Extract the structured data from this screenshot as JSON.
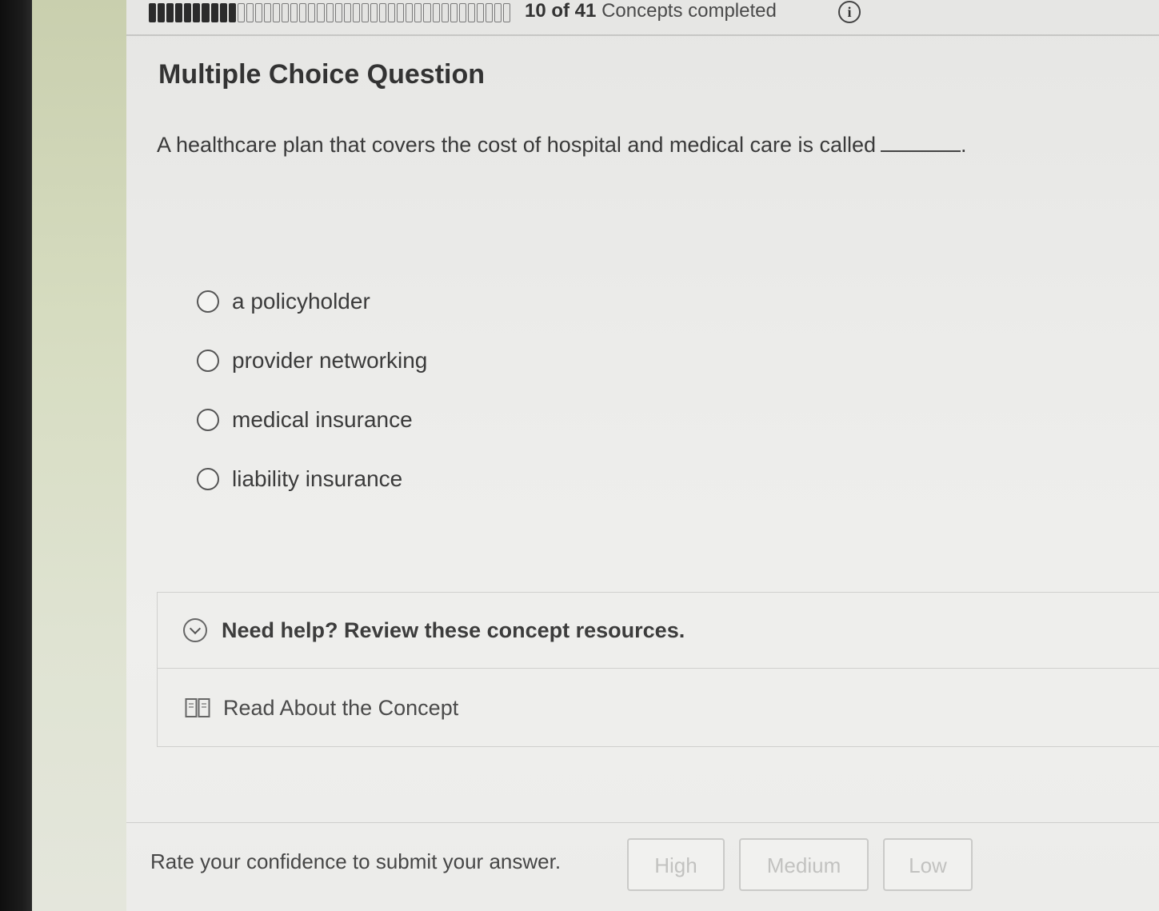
{
  "progress": {
    "completed": 10,
    "total": 41,
    "count_text": "10 of 41",
    "suffix_text": "Concepts completed",
    "info_icon_glyph": "i"
  },
  "question": {
    "type_label": "Multiple Choice Question",
    "prompt": "A healthcare plan that covers the cost of hospital and medical care is called",
    "prompt_end": "."
  },
  "options": [
    {
      "label": "a policyholder"
    },
    {
      "label": "provider networking"
    },
    {
      "label": "medical insurance"
    },
    {
      "label": "liability insurance"
    }
  ],
  "resources": {
    "header": "Need help? Review these concept resources.",
    "link": "Read About the Concept"
  },
  "confidence": {
    "label": "Rate your confidence to submit your answer.",
    "high": "High",
    "medium": "Medium",
    "low": "Low"
  },
  "icons": {
    "info": "info-icon",
    "expand": "chevron-down-circle-icon",
    "book": "book-icon"
  }
}
